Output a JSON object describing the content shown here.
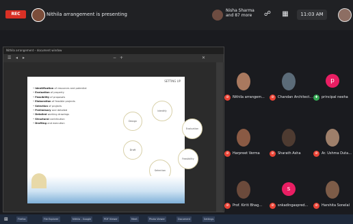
{
  "meeting": {
    "rec_label": "REC",
    "presenting_text": "Nithila arrangement is presenting",
    "viewer_name_line1": "Nisha Sharma",
    "viewer_name_line2": "and 87 more",
    "time": "11:03 AM"
  },
  "shared_screen": {
    "title_bar": "Nithila arrangement – document window",
    "slide_tag": "SETTING UP",
    "bullets": [
      {
        "title": "Identification",
        "rest": " of resources and potential"
      },
      {
        "title": "Evaluation",
        "rest": " of property"
      },
      {
        "title": "Feasibility",
        "rest": " of proposals"
      },
      {
        "title": "Elaboration",
        "rest": " of feasible projects"
      },
      {
        "title": "Selection",
        "rest": " of projects"
      },
      {
        "title": "Preliminary",
        "rest": " and detailed"
      },
      {
        "title": "Detailed",
        "rest": " working drawings"
      },
      {
        "title": "Structural",
        "rest": " contribution"
      },
      {
        "title": "Drafting",
        "rest": " and execution"
      }
    ],
    "circle_labels": [
      "Identify",
      "Evaluation",
      "Feasibility",
      "Selection",
      "Draft",
      "Design"
    ]
  },
  "participants": [
    {
      "name": "Nithila arrangem...",
      "avatar_color": "#a9795f"
    },
    {
      "name": "Chandan Architect...",
      "avatar_color": "#5b6b78"
    },
    {
      "name": "principal neeha",
      "avatar_color": "#e91e63",
      "letter": "p"
    },
    {
      "name": "Harpreet Verma",
      "avatar_color": "#8a5a44"
    },
    {
      "name": "Sharath Asha",
      "avatar_color": "#4e3b31"
    },
    {
      "name": "Ar. Ushma Duta...",
      "avatar_color": "#9e7f6a"
    },
    {
      "name": "Prof. Kiriti Bhag...",
      "avatar_color": "#6b4a3b"
    },
    {
      "name": "snkadingaspred...",
      "avatar_color": "#e91e63",
      "letter": "s"
    },
    {
      "name": "Harshita Sonelal",
      "avatar_color": "#7d5c48"
    }
  ],
  "taskbar": {
    "items": [
      "Firefox",
      "File Explorer",
      "Nithila - Google",
      "PDF Viewer",
      "Meet",
      "Photo Viewer",
      "Document",
      "Settings"
    ]
  },
  "colors": {
    "rec": "#d93025",
    "muted_mic": "#ea4335",
    "background": "#1a1b1f"
  }
}
